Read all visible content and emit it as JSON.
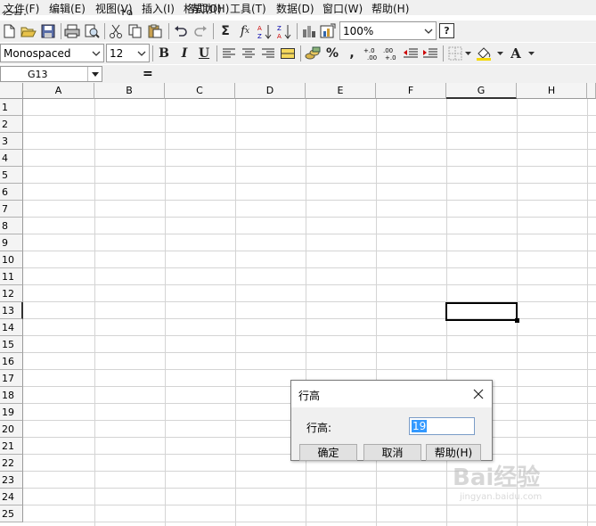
{
  "menu": {
    "items": [
      "文件(F)",
      "编辑(E)",
      "视图(V)",
      "插入(I)",
      "格式(O)",
      "帮助(H)",
      "工具(T)",
      "数据(D)",
      "窗口(W)",
      "帮助(H)"
    ],
    "ghost_label": "行高:",
    "ghost_value": "19"
  },
  "toolbar": {
    "zoom": "100%",
    "help_button_label": "?",
    "icons": [
      "new-icon",
      "open-icon",
      "save-icon",
      "print-icon",
      "print-preview-icon",
      "cut-icon",
      "copy-icon",
      "paste-icon",
      "undo-icon",
      "redo-icon",
      "sum-icon",
      "function-icon",
      "sort-ascending-icon",
      "sort-descending-icon",
      "chart-icon",
      "chart-wizard-icon"
    ]
  },
  "format_toolbar": {
    "font": "Monospaced",
    "size": "12",
    "bold": "B",
    "italic": "I",
    "underline": "U",
    "percent": "%",
    "comma": ",",
    "font_color_label": "A"
  },
  "formula_bar": {
    "cell_ref": "G13",
    "equals": "="
  },
  "sheet": {
    "columns": [
      "A",
      "B",
      "C",
      "D",
      "E",
      "F",
      "G",
      "H"
    ],
    "rows": [
      "1",
      "2",
      "3",
      "4",
      "5",
      "6",
      "7",
      "8",
      "9",
      "10",
      "11",
      "12",
      "13",
      "14",
      "15",
      "16",
      "17",
      "18",
      "19",
      "20",
      "21",
      "22",
      "23",
      "24",
      "25"
    ],
    "selected_cell": "G13"
  },
  "dialog": {
    "title": "行高",
    "label": "行高:",
    "value": "19",
    "buttons": {
      "ok": "确定",
      "cancel": "取消",
      "help": "帮助(H)"
    }
  },
  "watermark": {
    "text": "Bai经验",
    "sub": "jingyan.baidu.com"
  },
  "colors": {
    "chrome_bg": "#f0f0f0",
    "header_bg": "#f4f4f4",
    "gridline": "#d4d4d4",
    "selection_bg": "#3399ff"
  }
}
